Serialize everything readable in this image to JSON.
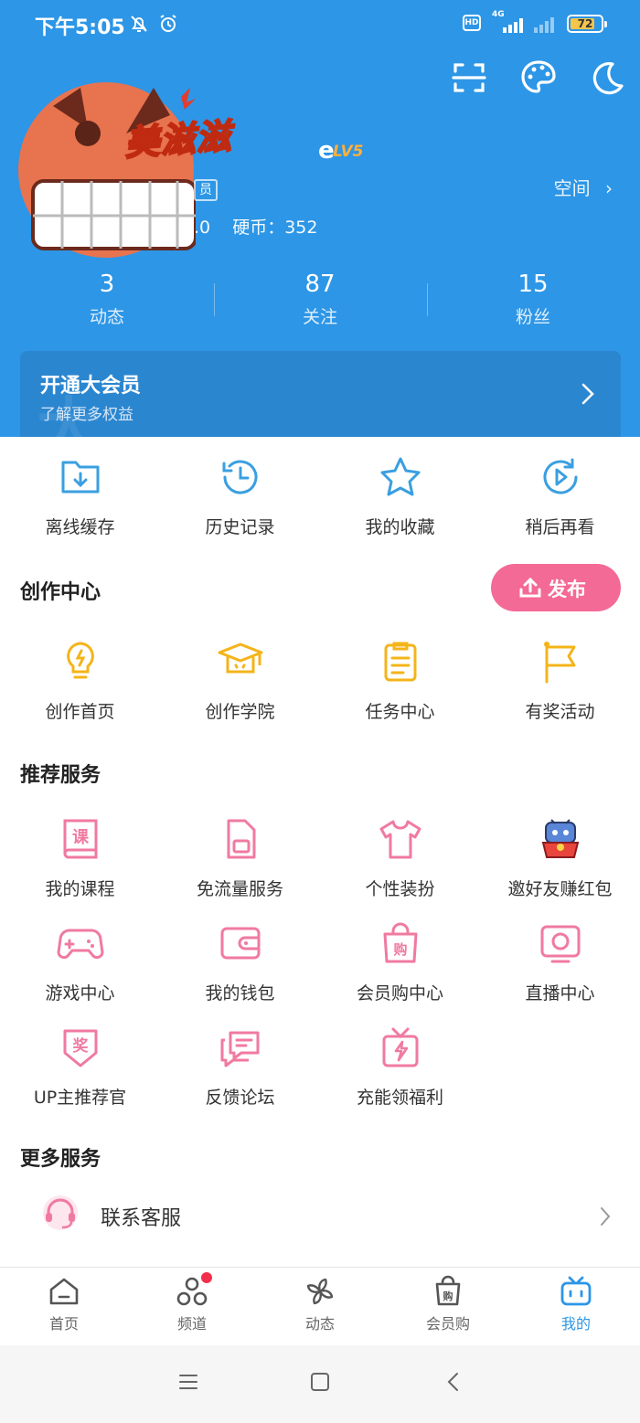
{
  "status_bar": {
    "time": "下午5:05",
    "hd_label": "HD",
    "network": "4G",
    "battery": "72"
  },
  "profile": {
    "nickname": "美滋滋",
    "nickname_tail": "e",
    "level": "LV5",
    "badge_char": "员",
    "coin_prefix": ".0",
    "coin_text": "硬币：352",
    "space_link": "空间"
  },
  "stats": [
    {
      "num": "3",
      "label": "动态"
    },
    {
      "num": "87",
      "label": "关注"
    },
    {
      "num": "15",
      "label": "粉丝"
    }
  ],
  "vip": {
    "title": "开通大会员",
    "subtitle": "了解更多权益",
    "deco": "大"
  },
  "quick_actions": [
    {
      "label": "离线缓存",
      "icon": "download-folder-icon"
    },
    {
      "label": "历史记录",
      "icon": "history-clock-icon"
    },
    {
      "label": "我的收藏",
      "icon": "star-icon"
    },
    {
      "label": "稍后再看",
      "icon": "watch-later-icon"
    }
  ],
  "creation_center": {
    "title": "创作中心",
    "publish_label": "发布",
    "items": [
      {
        "label": "创作首页",
        "icon": "lightbulb-icon"
      },
      {
        "label": "创作学院",
        "icon": "graduation-cap-icon"
      },
      {
        "label": "任务中心",
        "icon": "task-list-icon"
      },
      {
        "label": "有奖活动",
        "icon": "flag-icon"
      }
    ]
  },
  "recommended": {
    "title": "推荐服务",
    "items": [
      {
        "label": "我的课程",
        "icon": "course-book-icon"
      },
      {
        "label": "免流量服务",
        "icon": "sim-card-icon"
      },
      {
        "label": "个性装扮",
        "icon": "tshirt-icon"
      },
      {
        "label": "邀好友赚红包",
        "icon": "mascot-red-envelope-icon"
      },
      {
        "label": "游戏中心",
        "icon": "gamepad-icon"
      },
      {
        "label": "我的钱包",
        "icon": "wallet-icon"
      },
      {
        "label": "会员购中心",
        "icon": "shopping-bag-icon"
      },
      {
        "label": "直播中心",
        "icon": "live-tv-icon"
      },
      {
        "label": "UP主推荐官",
        "icon": "reward-shield-icon"
      },
      {
        "label": "反馈论坛",
        "icon": "chat-bubbles-icon"
      },
      {
        "label": "充能领福利",
        "icon": "gift-bolt-icon"
      }
    ],
    "course_char": "课",
    "bag_char": "购",
    "reward_char": "奖"
  },
  "more_services": {
    "title": "更多服务",
    "items": [
      {
        "label": "联系客服",
        "icon": "headset-icon"
      }
    ]
  },
  "tabbar": [
    {
      "label": "首页",
      "icon": "home-icon"
    },
    {
      "label": "频道",
      "icon": "channel-icon"
    },
    {
      "label": "动态",
      "icon": "pinwheel-icon"
    },
    {
      "label": "会员购",
      "icon": "shopping-bag-icon"
    },
    {
      "label": "我的",
      "icon": "tv-icon"
    }
  ],
  "tabbar_bag_char": "购",
  "colors": {
    "header_blue": "#2d96e6",
    "accent_blue": "#3a9fe0",
    "creation_yellow": "#f4b41a",
    "service_pink": "#f07aa0",
    "publish_pink": "#f46a97"
  }
}
